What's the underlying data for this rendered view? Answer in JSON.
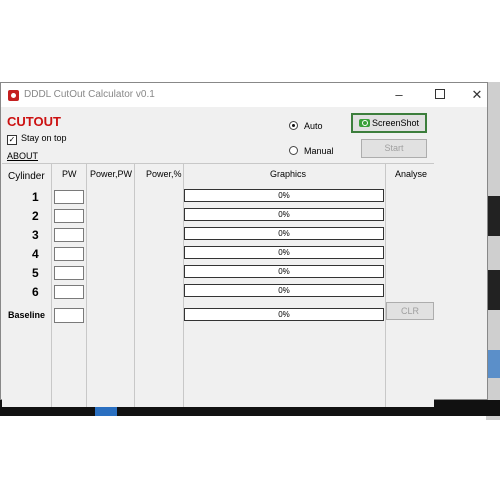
{
  "window": {
    "title": "DDDL CutOut Calculator v0.1"
  },
  "app": {
    "name": "CUTOUT",
    "stay_on_top": "Stay on top",
    "about": "ABOUT"
  },
  "mode": {
    "auto": "Auto",
    "manual": "Manual",
    "selected": "Auto"
  },
  "buttons": {
    "screenshot": "ScreenShot",
    "start": "Start",
    "clr": "CLR"
  },
  "table": {
    "headers": {
      "cylinder": "Cylinder",
      "pw": "PW",
      "power_pw": "Power,PW",
      "power_pct": "Power,%",
      "graphics": "Graphics",
      "analyse": "Analyse"
    },
    "rows": [
      {
        "label": "1",
        "pw": "",
        "progress": "0%"
      },
      {
        "label": "2",
        "pw": "",
        "progress": "0%"
      },
      {
        "label": "3",
        "pw": "",
        "progress": "0%"
      },
      {
        "label": "4",
        "pw": "",
        "progress": "0%"
      },
      {
        "label": "5",
        "pw": "",
        "progress": "0%"
      },
      {
        "label": "6",
        "pw": "",
        "progress": "0%"
      }
    ],
    "baseline": {
      "label": "Baseline",
      "pw": "",
      "progress": "0%"
    }
  },
  "colors": {
    "title_red": "#cc1111",
    "screenshot_border": "#3c7e3c"
  }
}
